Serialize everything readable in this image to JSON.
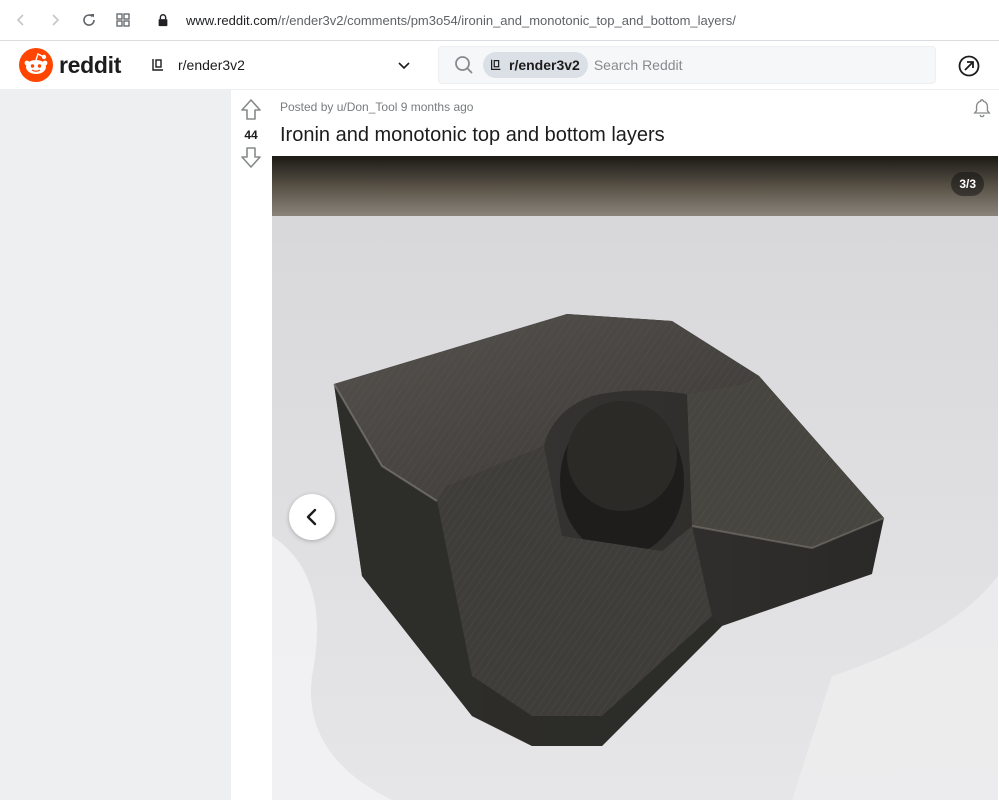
{
  "browser": {
    "url_host": "www.reddit.com",
    "url_path": "/r/ender3v2/comments/pm3o54/ironin_and_monotonic_top_and_bottom_layers/"
  },
  "header": {
    "logo_text": "reddit",
    "community": "r/ender3v2",
    "search_chip": "r/ender3v2",
    "search_placeholder": "Search Reddit"
  },
  "post": {
    "votes": "44",
    "meta": "Posted by u/Don_Tool 9 months ago",
    "title": "Ironin and monotonic top and bottom layers",
    "gallery_counter": "3/3"
  },
  "colors": {
    "brand": "#ff4500",
    "page_bg": "#edeff1"
  }
}
